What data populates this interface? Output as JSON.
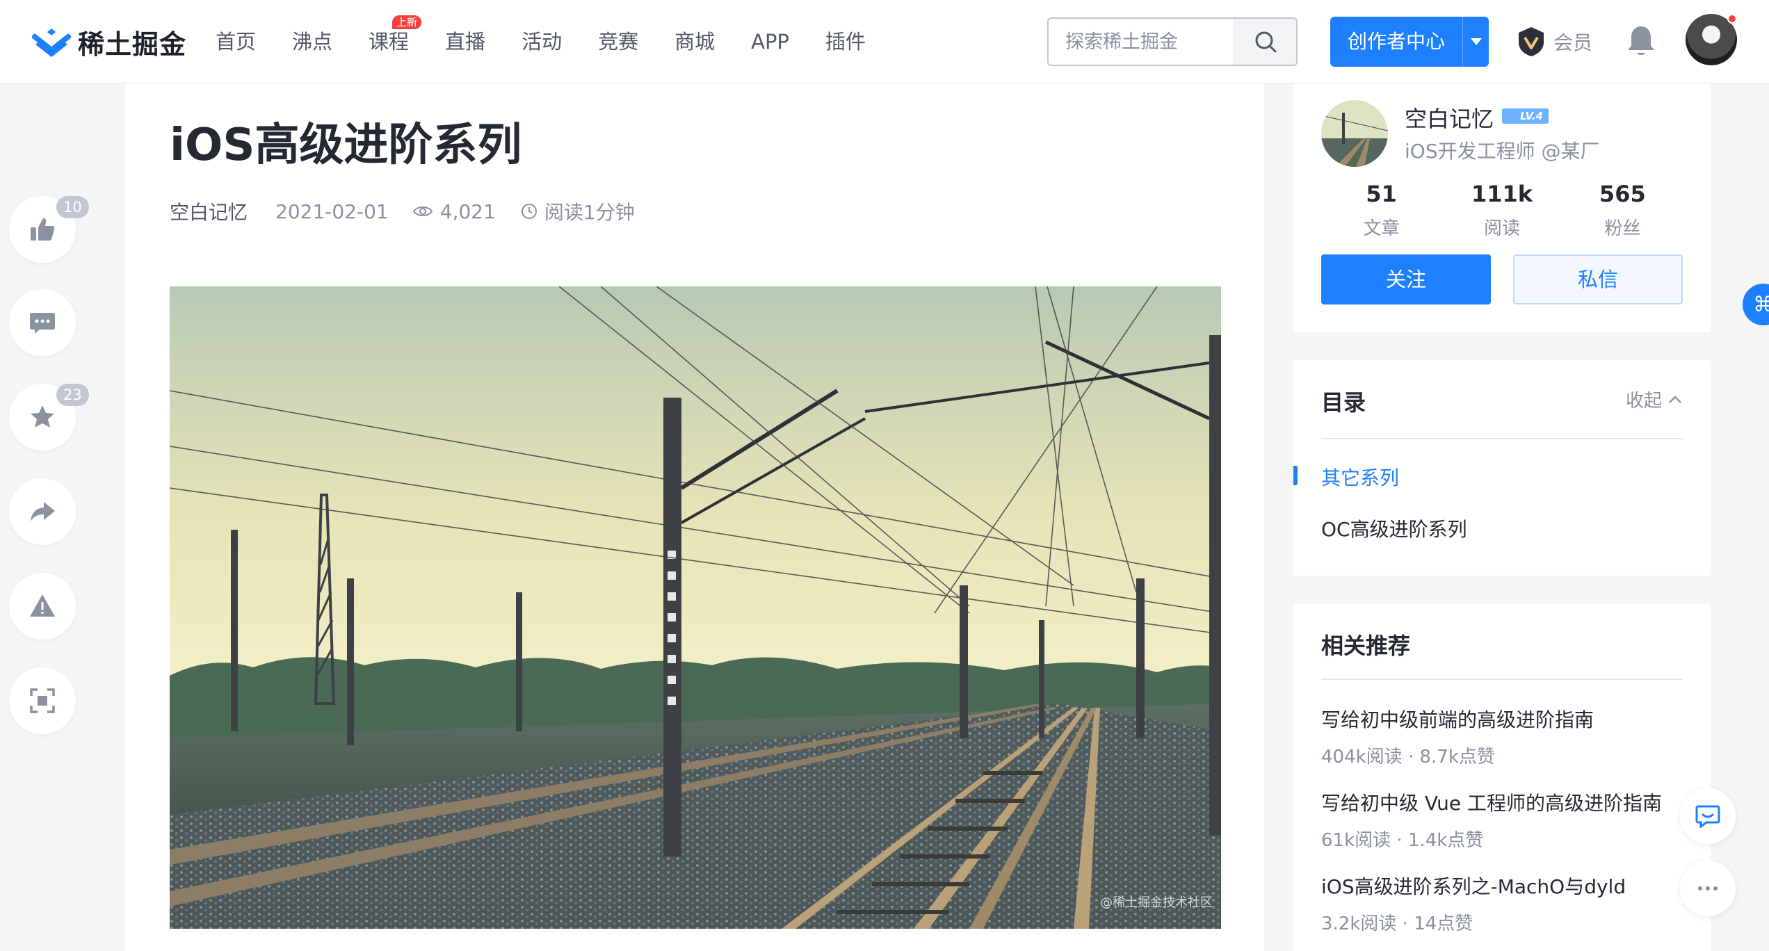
{
  "header": {
    "logo_text": "稀土掘金",
    "nav": [
      {
        "label": "首页"
      },
      {
        "label": "沸点"
      },
      {
        "label": "课程",
        "badge": "上新"
      },
      {
        "label": "直播"
      },
      {
        "label": "活动"
      },
      {
        "label": "竞赛"
      },
      {
        "label": "商城"
      },
      {
        "label": "APP"
      },
      {
        "label": "插件"
      }
    ],
    "search_placeholder": "探索稀土掘金",
    "creator_label": "创作者中心",
    "member_label": "会员",
    "accent_color": "#1e80ff"
  },
  "side_panel": {
    "like_count": "10",
    "collect_count": "23",
    "icons": [
      "thumbs-up-icon",
      "comment-icon",
      "star-icon",
      "share-icon",
      "warning-icon",
      "fullscreen-icon"
    ]
  },
  "article": {
    "title": "iOS高级进阶系列",
    "author": "空白记忆",
    "date": "2021-02-01",
    "views": "4,021",
    "read_time": "阅读1分钟",
    "cover_watermark": "@稀土掘金技术社区"
  },
  "author_card": {
    "name": "空白记忆",
    "level": "LV.4",
    "title": "iOS开发工程师 @某厂",
    "stats": [
      {
        "num": "51",
        "label": "文章"
      },
      {
        "num": "111k",
        "label": "阅读"
      },
      {
        "num": "565",
        "label": "粉丝"
      }
    ],
    "follow_label": "关注",
    "message_label": "私信"
  },
  "toc": {
    "title": "目录",
    "collapse_label": "收起",
    "items": [
      "其它系列",
      "OC高级进阶系列"
    ]
  },
  "recommend": {
    "title": "相关推荐",
    "items": [
      {
        "title": "写给初中级前端的高级进阶指南",
        "meta": "404k阅读 · 8.7k点赞"
      },
      {
        "title": "写给初中级 Vue 工程师的高级进阶指南",
        "meta": "61k阅读 · 1.4k点赞"
      },
      {
        "title": "iOS高级进阶系列之-MachO与dyld",
        "meta": "3.2k阅读 · 14点赞"
      }
    ]
  }
}
